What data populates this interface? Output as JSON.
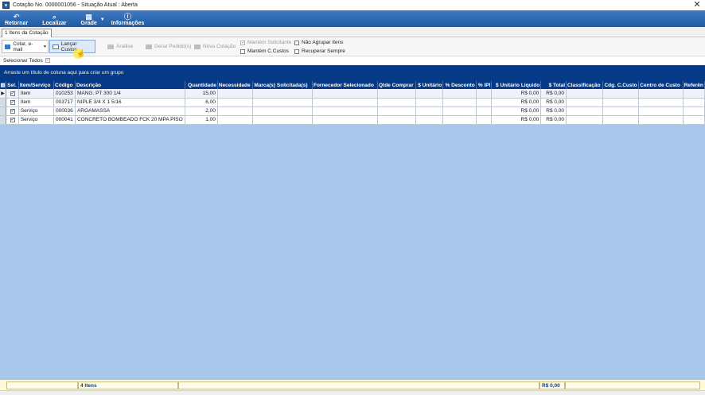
{
  "window": {
    "title": "Cotação No. 0000001056 - Situação Atual : Aberta"
  },
  "ribbon": {
    "buttons": [
      {
        "label": "Retornar",
        "icon": "return-arrow-icon"
      },
      {
        "label": "Localizar",
        "icon": "search-icon"
      },
      {
        "label": "Grade",
        "icon": "grid-icon"
      },
      {
        "label": "Informações",
        "icon": "info-icon"
      }
    ]
  },
  "tabs": [
    {
      "label": "1 Itens da Cotação"
    }
  ],
  "toolbar": {
    "cotar_email": "Cotar, e-mail",
    "lancar_custos": "Lançar Custos",
    "analise": "Análise",
    "gerar_pedidos": "Gerar Pedido(s)",
    "nova_cotacao": "Nova Cotação",
    "mantem_solicitante": "Mantém Solicitante",
    "mantem_ccustos": "Mantém C.Custos",
    "nao_agrupar_itens": "Não Agrupar Itens",
    "recuperar_sempre": "Recuperar Sempre"
  },
  "select_all": "Selecionar Todos",
  "group_panel": "Arraste um título de coluna aqui para criar um grupo",
  "grid": {
    "columns": [
      "Sel.",
      "Item/Serviço",
      "Código",
      "Descrição",
      "Quantidade",
      "Necessidade",
      "Marca(s) Solicitada(s)",
      "Fornecedor Selecionado",
      "Qtde Comprar",
      "$ Unitário",
      "% Desconto",
      "% IPI",
      "$ Unitário Líquido",
      "$ Total",
      "Classificação",
      "Cdg. C.Custo",
      "Centro de Custo",
      "Referên"
    ],
    "rows": [
      {
        "tipo": "Item",
        "codigo": "010253",
        "descricao": "MANG. PT 300 1/4",
        "quantidade": "15,00",
        "total": "R$ 0,00"
      },
      {
        "tipo": "Item",
        "codigo": "003717",
        "descricao": "NIPLE 3/4 X 1 5/16",
        "quantidade": "6,00",
        "total": "R$ 0,00"
      },
      {
        "tipo": "Serviço",
        "codigo": "000036",
        "descricao": "ARGAMASSA",
        "quantidade": "2,00",
        "total": "R$ 0,00"
      },
      {
        "tipo": "Serviço",
        "codigo": "000041",
        "descricao": "CONCRETO BOMBEADO FCK 20 MPA PISO",
        "quantidade": "1,00",
        "total": "R$ 0,00"
      }
    ]
  },
  "footer": {
    "count": "4 Itens",
    "total": "R$ 0,00"
  },
  "colors": {
    "header_blue": "#063a86",
    "ribbon_blue": "#2a68b2",
    "grid_bg": "#a7c6ea",
    "footer_yellow": "#fdfad6"
  }
}
